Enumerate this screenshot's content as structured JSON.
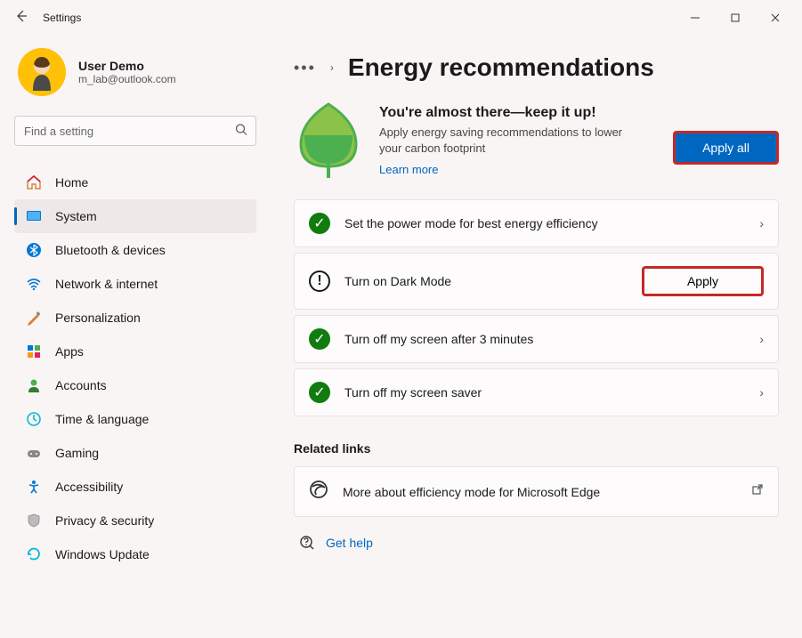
{
  "window": {
    "title": "Settings"
  },
  "user": {
    "name": "User Demo",
    "email": "m_lab@outlook.com"
  },
  "search": {
    "placeholder": "Find a setting"
  },
  "nav": [
    {
      "label": "Home"
    },
    {
      "label": "System"
    },
    {
      "label": "Bluetooth & devices"
    },
    {
      "label": "Network & internet"
    },
    {
      "label": "Personalization"
    },
    {
      "label": "Apps"
    },
    {
      "label": "Accounts"
    },
    {
      "label": "Time & language"
    },
    {
      "label": "Gaming"
    },
    {
      "label": "Accessibility"
    },
    {
      "label": "Privacy & security"
    },
    {
      "label": "Windows Update"
    }
  ],
  "page": {
    "title": "Energy recommendations",
    "hero_title": "You're almost there—keep it up!",
    "hero_body": "Apply energy saving recommendations to lower your carbon footprint",
    "learn_more": "Learn more",
    "apply_all": "Apply all"
  },
  "recs": [
    {
      "label": "Set the power mode for best energy efficiency",
      "status": "ok"
    },
    {
      "label": "Turn on Dark Mode",
      "status": "warn",
      "apply": "Apply"
    },
    {
      "label": "Turn off my screen after 3 minutes",
      "status": "ok"
    },
    {
      "label": "Turn off my screen saver",
      "status": "ok"
    }
  ],
  "related": {
    "heading": "Related links",
    "edge": "More about efficiency mode for Microsoft Edge"
  },
  "help": {
    "label": "Get help"
  }
}
